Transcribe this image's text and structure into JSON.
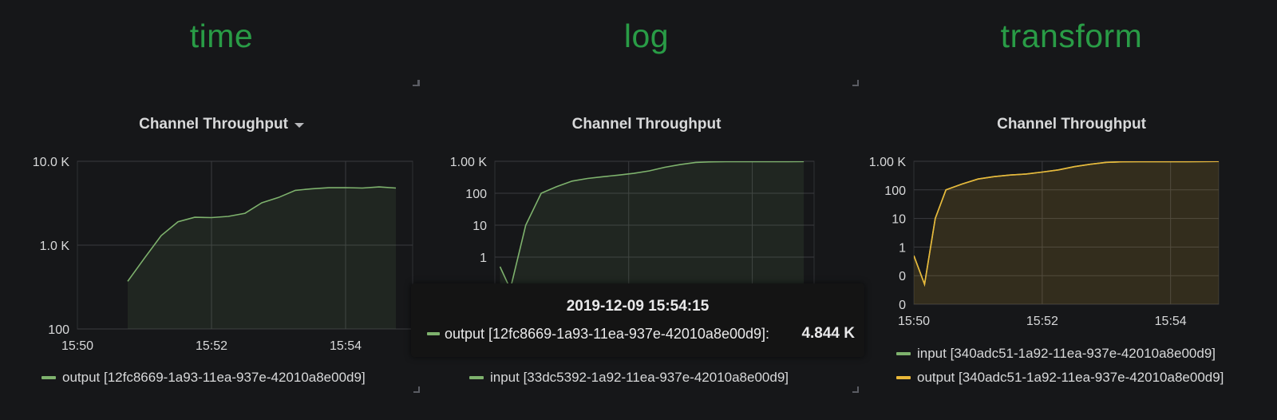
{
  "sections": [
    {
      "title": "time",
      "panel_title": "Channel Throughput",
      "legend": [
        {
          "label": "output [12fc8669-1a93-11ea-937e-42010a8e00d9]",
          "color": "#7eb26d"
        }
      ]
    },
    {
      "title": "log",
      "panel_title": "Channel Throughput",
      "legend": [
        {
          "label": "input [33dc5392-1a92-11ea-937e-42010a8e00d9]",
          "color": "#7eb26d"
        }
      ]
    },
    {
      "title": "transform",
      "panel_title": "Channel Throughput",
      "legend": [
        {
          "label": "input [340adc51-1a92-11ea-937e-42010a8e00d9]",
          "color": "#7eb26d"
        },
        {
          "label": "output [340adc51-1a92-11ea-937e-42010a8e00d9]",
          "color": "#eab839"
        }
      ]
    }
  ],
  "tooltip": {
    "time": "2019-12-09 15:54:15",
    "series": "output [12fc8669-1a93-11ea-937e-42010a8e00d9]:",
    "value": "4.844 K",
    "color": "#7eb26d"
  },
  "chart_data": [
    {
      "type": "area",
      "scale": "log",
      "x": [
        "15:50:45",
        "15:51:00",
        "15:51:15",
        "15:51:30",
        "15:51:45",
        "15:52:00",
        "15:52:15",
        "15:52:30",
        "15:52:45",
        "15:53:00",
        "15:53:15",
        "15:53:30",
        "15:53:45",
        "15:54:00",
        "15:54:15",
        "15:54:30",
        "15:54:45"
      ],
      "series": [
        {
          "name": "output [12fc8669-1a93-11ea-937e-42010a8e00d9]",
          "color": "#7eb26d",
          "values": [
            370,
            700,
            1300,
            1900,
            2150,
            2130,
            2200,
            2400,
            3200,
            3700,
            4500,
            4700,
            4844,
            4850,
            4800,
            4950,
            4800
          ]
        }
      ],
      "yticks": [
        "10.0 K",
        "1.0 K",
        "100"
      ],
      "ytick_values": [
        10000,
        1000,
        100
      ],
      "xticks": [
        "15:50",
        "15:52",
        "15:54"
      ],
      "ylim": [
        100,
        10000
      ],
      "xlim": [
        "15:50:00",
        "15:55:00"
      ],
      "grid": true
    },
    {
      "type": "area",
      "scale": "log",
      "x": [
        "15:49:55",
        "15:50:05",
        "15:50:20",
        "15:50:35",
        "15:50:50",
        "15:51:05",
        "15:51:20",
        "15:51:35",
        "15:51:50",
        "15:52:05",
        "15:52:20",
        "15:52:35",
        "15:52:50",
        "15:53:05",
        "15:53:20",
        "15:53:35",
        "15:53:50",
        "15:54:05",
        "15:54:20",
        "15:54:35",
        "15:54:50"
      ],
      "series": [
        {
          "name": "input [33dc5392-1a92-11ea-937e-42010a8e00d9]",
          "color": "#7eb26d",
          "values": [
            0.5,
            0.08,
            10,
            100,
            160,
            240,
            290,
            330,
            370,
            420,
            500,
            650,
            790,
            920,
            960,
            970,
            970,
            975,
            970,
            980,
            985
          ]
        }
      ],
      "yticks": [
        "1.00 K",
        "100",
        "10",
        "1"
      ],
      "ytick_values": [
        1000,
        100,
        10,
        1
      ],
      "ylim": [
        0.1,
        1000
      ],
      "grid": true
    },
    {
      "type": "area",
      "scale": "log",
      "x": [
        "15:50:00",
        "15:50:10",
        "15:50:20",
        "15:50:30",
        "15:50:45",
        "15:51:00",
        "15:51:15",
        "15:51:30",
        "15:51:45",
        "15:52:00",
        "15:52:15",
        "15:52:30",
        "15:52:45",
        "15:53:00",
        "15:53:15",
        "15:53:30",
        "15:53:45",
        "15:54:00",
        "15:54:15",
        "15:54:30",
        "15:54:45"
      ],
      "series": [
        {
          "name": "input [340adc51-1a92-11ea-937e-42010a8e00d9]",
          "color": "#7eb26d",
          "values": [
            0.5,
            0.05,
            10,
            100,
            160,
            240,
            290,
            330,
            360,
            420,
            500,
            650,
            790,
            920,
            960,
            970,
            970,
            975,
            970,
            980,
            985
          ]
        },
        {
          "name": "output [340adc51-1a92-11ea-937e-42010a8e00d9]",
          "color": "#eab839",
          "values": [
            0.5,
            0.05,
            10,
            100,
            160,
            240,
            290,
            330,
            360,
            420,
            500,
            650,
            790,
            920,
            960,
            970,
            970,
            975,
            970,
            980,
            985
          ]
        }
      ],
      "yticks": [
        "1.00 K",
        "100",
        "10",
        "1",
        "0",
        "0"
      ],
      "ytick_values": [
        1000,
        100,
        10,
        1,
        0.1,
        0.01
      ],
      "xticks": [
        "15:50",
        "15:52",
        "15:54"
      ],
      "ylim": [
        0.01,
        1000
      ],
      "xlim": [
        "15:50:00",
        "15:55:00"
      ],
      "grid": true
    }
  ]
}
